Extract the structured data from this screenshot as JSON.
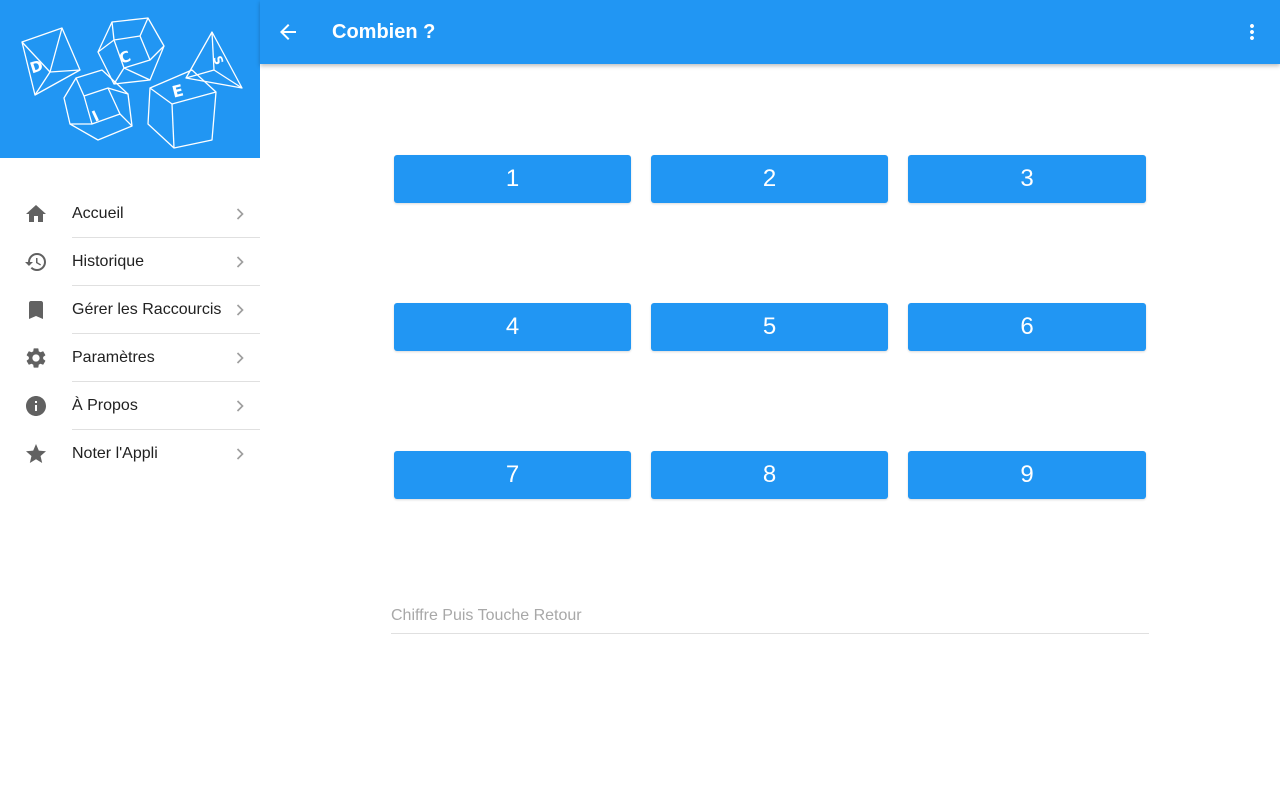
{
  "app": {
    "colors": {
      "primary": "#2196f3",
      "icon": "#616161",
      "text": "#212121",
      "chevron": "#9e9e9e"
    },
    "logo_letters": [
      "D",
      "C",
      "E",
      "I",
      "S"
    ]
  },
  "header": {
    "title": "Combien ?",
    "back_icon": "arrow-left-icon",
    "more_icon": "more-vertical-icon"
  },
  "sidebar": {
    "items": [
      {
        "label": "Accueil",
        "icon": "home-icon"
      },
      {
        "label": "Historique",
        "icon": "history-icon"
      },
      {
        "label": "Gérer les Raccourcis",
        "icon": "bookmark-icon"
      },
      {
        "label": "Paramètres",
        "icon": "settings-icon"
      },
      {
        "label": "À Propos",
        "icon": "info-icon"
      },
      {
        "label": "Noter l'Appli",
        "icon": "star-icon"
      }
    ]
  },
  "numpad": {
    "keys": [
      "1",
      "2",
      "3",
      "4",
      "5",
      "6",
      "7",
      "8",
      "9"
    ]
  },
  "entry": {
    "value": "",
    "placeholder": "Chiffre Puis Touche Retour"
  }
}
